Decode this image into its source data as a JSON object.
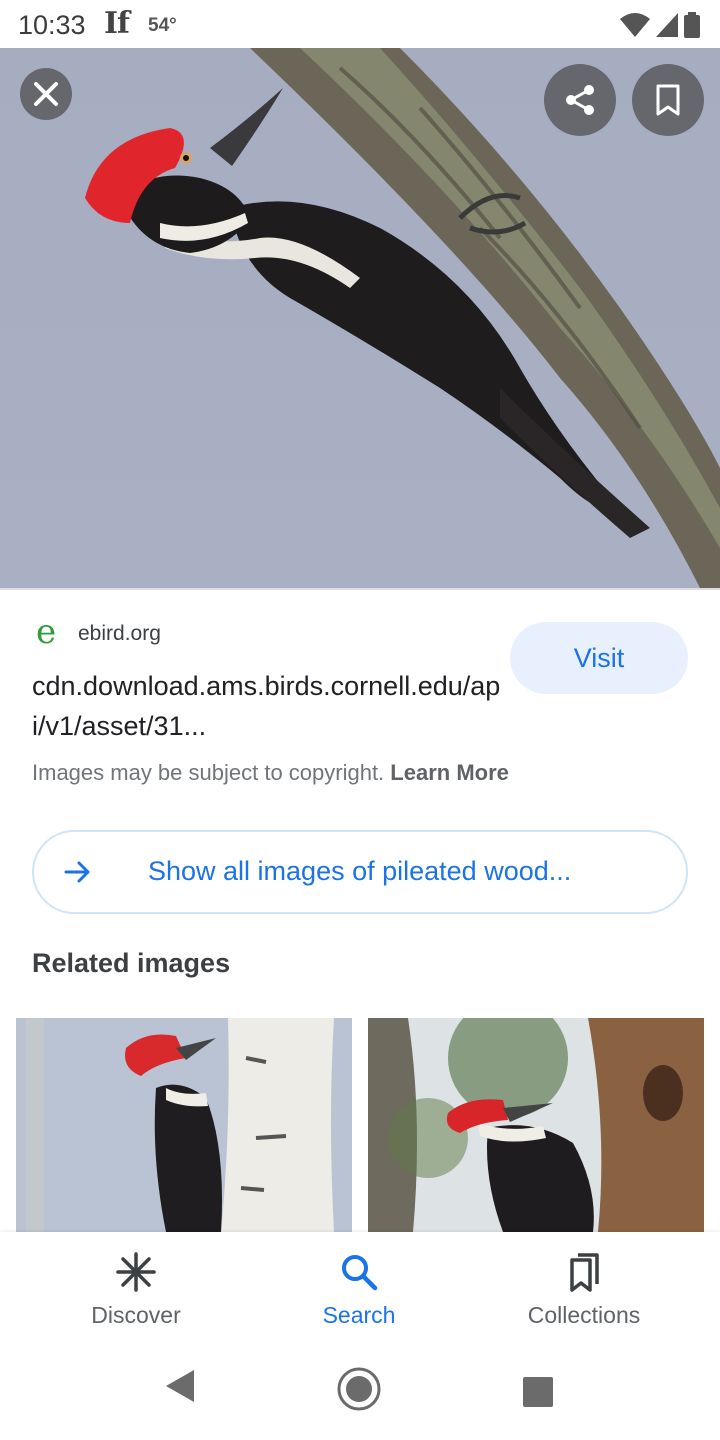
{
  "status_bar": {
    "time": "10:33",
    "app_icon_text": "If",
    "temperature": "54°",
    "icons": [
      "wifi-icon",
      "signal-icon",
      "battery-icon"
    ]
  },
  "hero": {
    "actions": [
      "close-icon",
      "share-icon",
      "bookmark-icon"
    ]
  },
  "source": {
    "favicon_letter": "e",
    "domain": "ebird.org",
    "url": "cdn.download.ams.birds.cornell.edu/api/v1/asset/31...",
    "visit_label": "Visit"
  },
  "copyright": {
    "text": "Images may be subject to copyright.",
    "learn_more": "Learn More"
  },
  "show_all": {
    "label": "Show all images of pileated wood..."
  },
  "related": {
    "heading": "Related images"
  },
  "bottom_nav": {
    "items": [
      {
        "label": "Discover",
        "icon": "asterisk-icon"
      },
      {
        "label": "Search",
        "icon": "search-icon",
        "active": true
      },
      {
        "label": "Collections",
        "icon": "collections-icon"
      }
    ]
  },
  "colors": {
    "accent": "#1a73e8",
    "visit_bg": "#e8f0fe",
    "favicon": "#2e9c3a"
  }
}
